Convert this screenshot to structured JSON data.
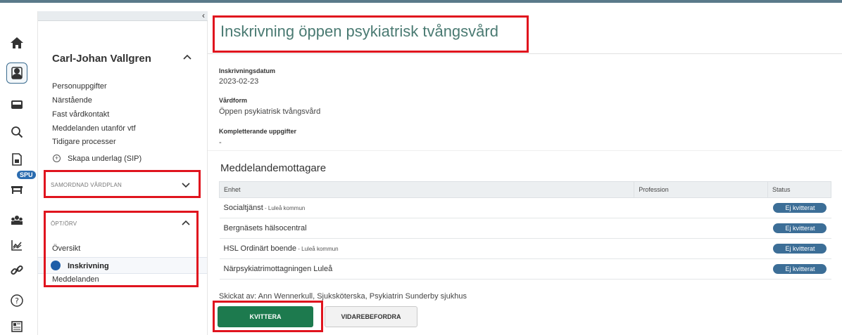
{
  "icon_rail": {
    "items": [
      {
        "icon": "home-icon"
      },
      {
        "icon": "patient-icon",
        "active": true
      },
      {
        "icon": "inbox-icon"
      },
      {
        "icon": "search-icon"
      },
      {
        "icon": "document-icon"
      },
      {
        "icon": "bed-icon",
        "badge": "SPU"
      },
      {
        "icon": "group-icon"
      },
      {
        "icon": "chart-icon"
      },
      {
        "icon": "link-icon"
      },
      {
        "icon": "help-icon"
      },
      {
        "icon": "news-icon"
      }
    ]
  },
  "sidebar": {
    "patient_name": "Carl-Johan Vallgren",
    "links": [
      "Personuppgifter",
      "Närstående",
      "Fast vårdkontakt",
      "Meddelanden utanför vtf",
      "Tidigare processer"
    ],
    "create_sip": "Skapa underlag (SIP)",
    "section_sip": "SAMORDNAD VÅRDPLAN",
    "section_opt": "ÖPT/ÖRV",
    "opt_items": {
      "oversikt": "Översikt",
      "inskrivning": "Inskrivning",
      "meddelanden": "Meddelanden"
    }
  },
  "main": {
    "title": "Inskrivning öppen psykiatrisk tvångsvård",
    "fields": [
      {
        "label": "Inskrivningsdatum",
        "value": "2023-02-23"
      },
      {
        "label": "Vårdform",
        "value": "Öppen psykiatrisk tvångsvård"
      },
      {
        "label": "Kompletterande uppgifter",
        "value": "-"
      }
    ],
    "recipients_title": "Meddelandemottagare",
    "table": {
      "headers": [
        "Enhet",
        "Profession",
        "Status"
      ],
      "rows": [
        {
          "enhet": "Socialtjänst",
          "kommun": " - Luleå kommun",
          "profession": "",
          "status": "Ej kvitterat"
        },
        {
          "enhet": "Bergnäsets hälsocentral",
          "kommun": "",
          "profession": "",
          "status": "Ej kvitterat"
        },
        {
          "enhet": "HSL Ordinärt boende",
          "kommun": " - Luleå kommun",
          "profession": "",
          "status": "Ej kvitterat"
        },
        {
          "enhet": "Närpsykiatrimottagningen Luleå",
          "kommun": "",
          "profession": "",
          "status": "Ej kvitterat"
        }
      ]
    },
    "sent_by": "Skickat av: Ann Wennerkull, Sjuksköterska, Psykiatrin Sunderby sjukhus",
    "buttons": {
      "kvittera": "KVITTERA",
      "vidarebefordra": "VIDAREBEFORDRA"
    }
  },
  "colors": {
    "title_green": "#4a7a72",
    "primary_button": "#1d7a4e",
    "status_pill": "#3c6e97",
    "highlight_red": "#e0141e",
    "topbar": "#5a7a8a"
  }
}
